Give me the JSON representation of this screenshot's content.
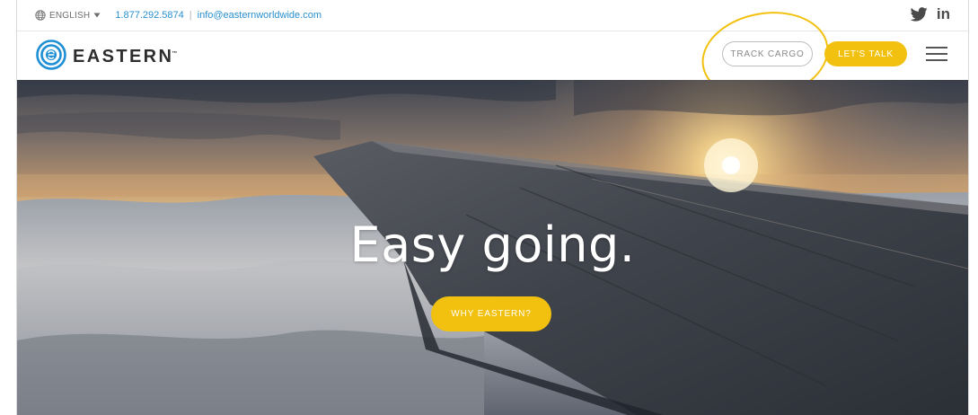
{
  "topbar": {
    "language_label": "ENGLISH",
    "phone": "1.877.292.5874",
    "separator": "|",
    "email": "info@easternworldwide.com",
    "social": {
      "twitter_icon": "twitter-icon",
      "linkedin_text": "in"
    }
  },
  "header": {
    "logo_text": "EASTERN",
    "logo_tm": "™",
    "track_cargo_label": "TRACK CARGO",
    "lets_talk_label": "LET'S TALK",
    "menu_icon": "hamburger-menu-icon"
  },
  "hero": {
    "headline": "Easy going.",
    "cta_label": "WHY EASTERN?",
    "image_subject": "airplane wing above clouds at sunset"
  },
  "colors": {
    "accent_yellow": "#f2c10f",
    "link_blue": "#2a8fcf",
    "logo_blue": "#1e8fd5",
    "text_dark": "#2d2d2d"
  }
}
